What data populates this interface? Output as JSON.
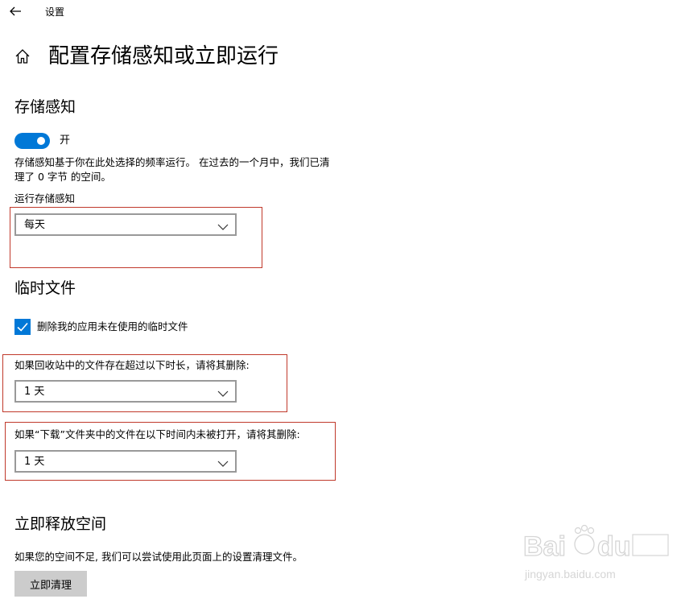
{
  "titlebar": {
    "title": "设置"
  },
  "page": {
    "title": "配置存储感知或立即运行"
  },
  "storage_sense": {
    "heading": "存储感知",
    "toggle_label": "开",
    "toggle_on": true,
    "description_line1": "存储感知基于你在此处选择的频率运行。 在过去的一个月中，我们已清",
    "description_line2": "理了 0 字节 的空间。",
    "run_label": "运行存储感知",
    "run_value": "每天"
  },
  "temp_files": {
    "heading": "临时文件",
    "delete_apps_checkbox_label": "删除我的应用未在使用的临时文件",
    "delete_apps_checked": true,
    "recycle_label": "如果回收站中的文件存在超过以下时长，请将其删除:",
    "recycle_value": "1 天",
    "downloads_label": "如果“下载”文件夹中的文件在以下时间内未被打开，请将其删除:",
    "downloads_value": "1 天"
  },
  "free_space": {
    "heading": "立即释放空间",
    "description": "如果您的空间不足, 我们可以尝试使用此页面上的设置清理文件。",
    "clean_button": "立即清理"
  },
  "watermark": {
    "url_text": "jingyan.baidu.com"
  },
  "colors": {
    "accent": "#0078d7",
    "highlight_box": "#c0392b"
  },
  "icons": [
    "back-arrow-icon",
    "home-icon",
    "chevron-down-icon",
    "checkmark-icon"
  ]
}
